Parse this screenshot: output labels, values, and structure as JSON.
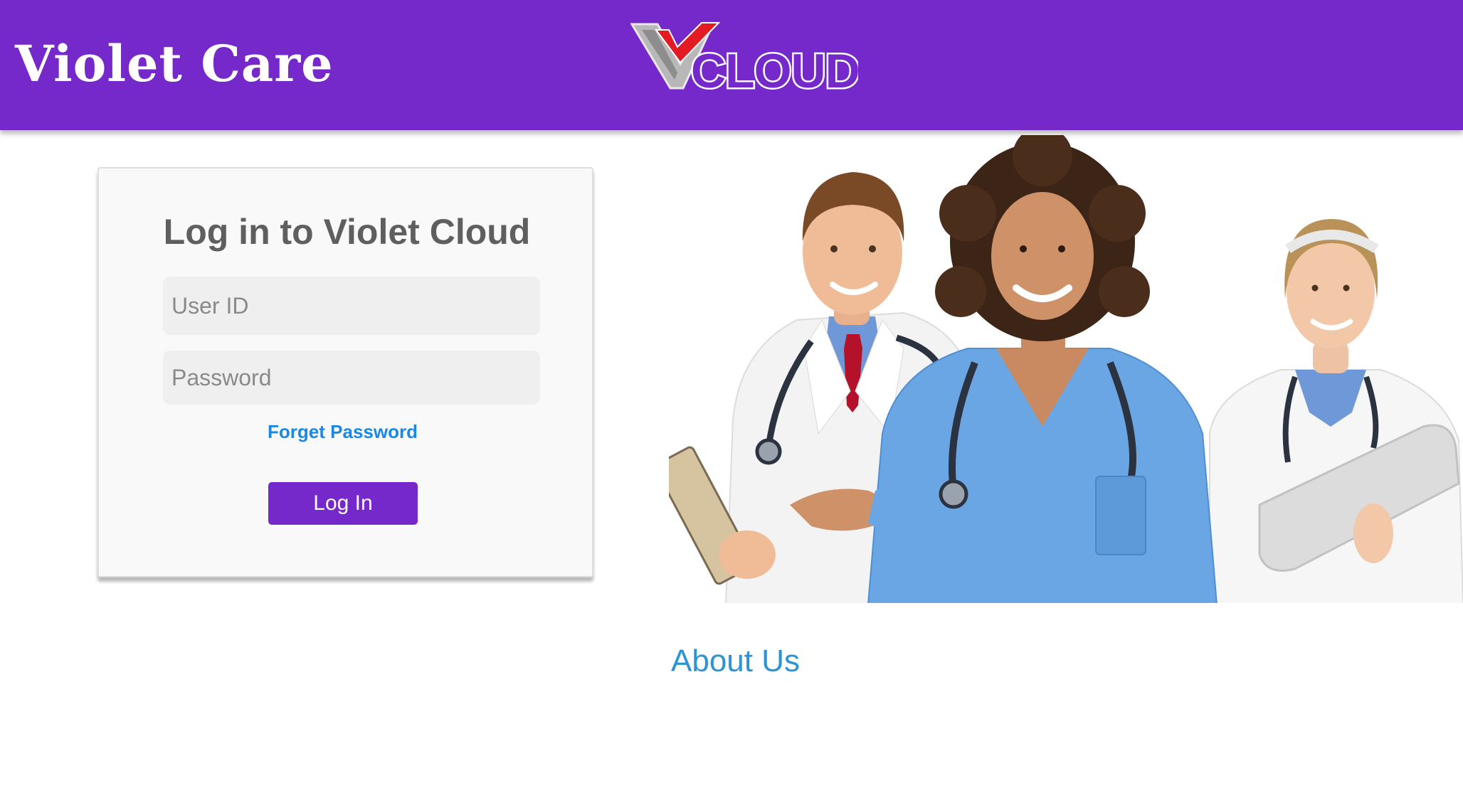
{
  "header": {
    "title": "Violet Care",
    "logo_text": "CLOUD",
    "logo_letter": "V",
    "brand_color": "#7629cb"
  },
  "login": {
    "heading": "Log in to Violet Cloud",
    "userid_placeholder": "User ID",
    "password_placeholder": "Password",
    "forgot_label": "Forget Password",
    "button_label": "Log In"
  },
  "hero": {
    "image": "medical-staff-photo"
  },
  "footer": {
    "about_label": "About Us"
  },
  "colors": {
    "accent": "#7629cb",
    "link": "#1a88e8",
    "about_link": "#2b93d6",
    "logo_check": "#e41b23"
  }
}
